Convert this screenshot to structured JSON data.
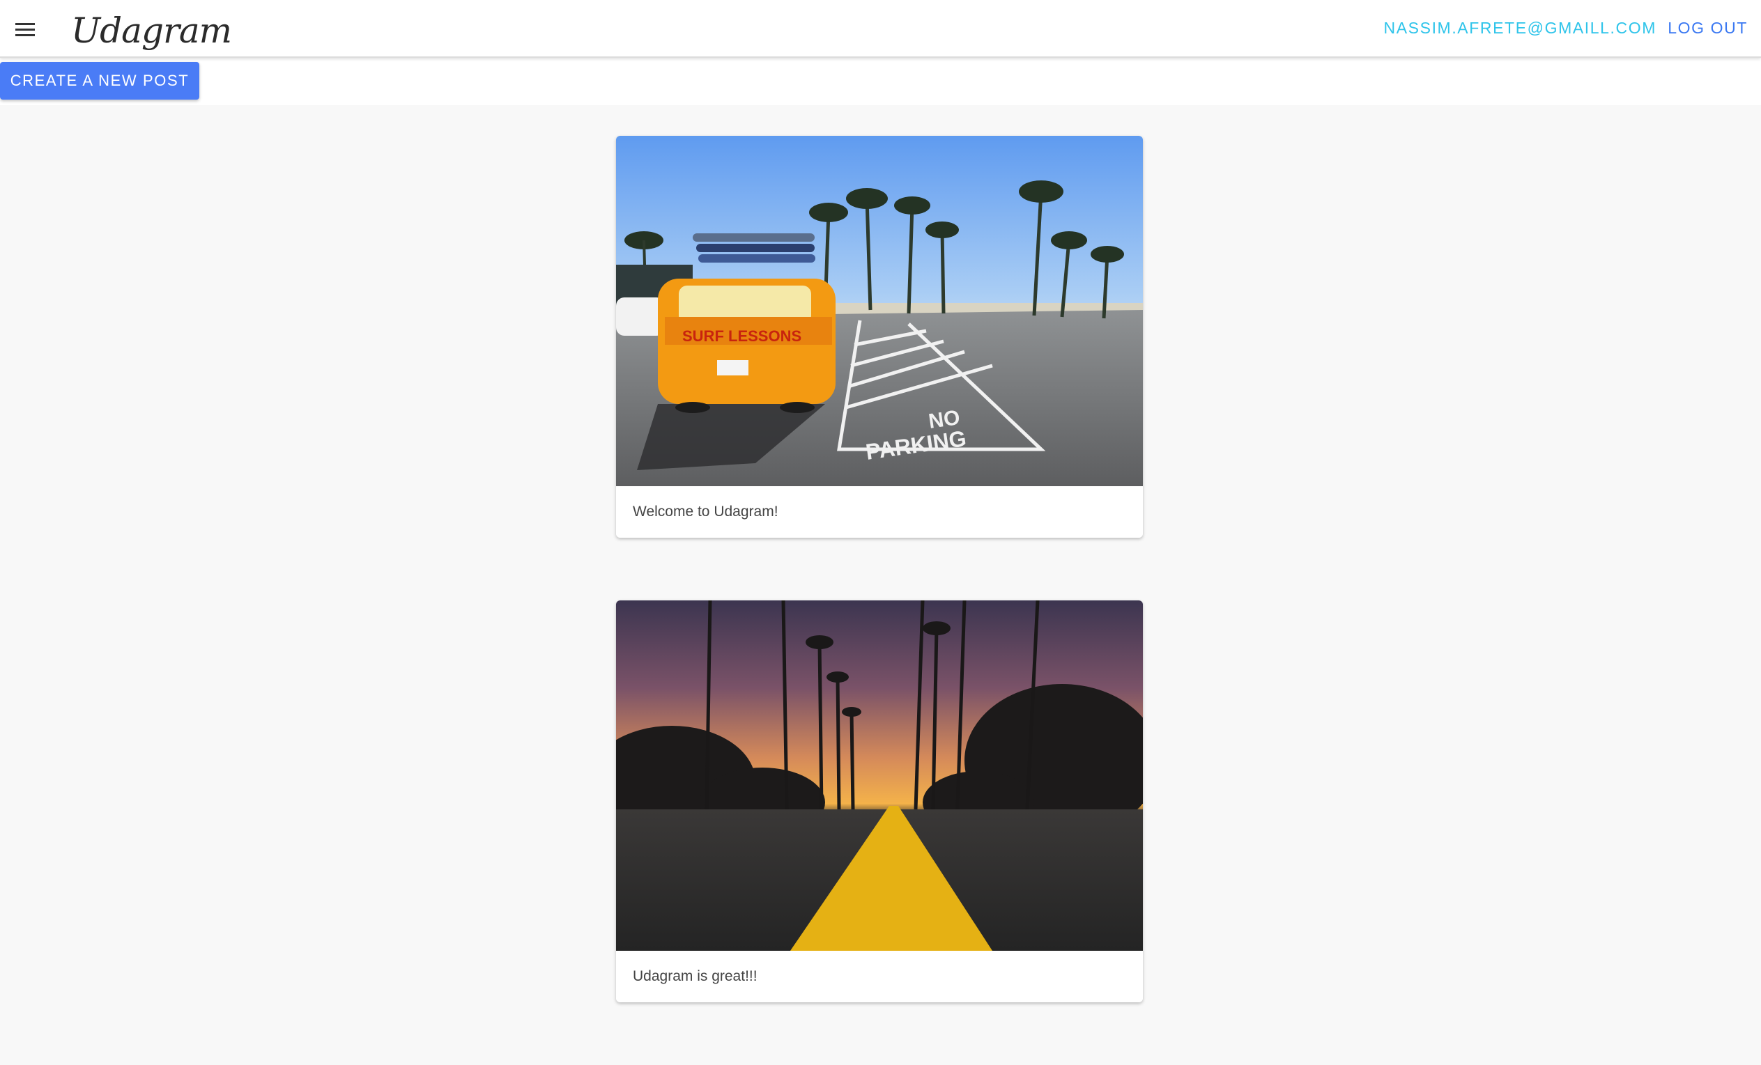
{
  "app": {
    "brand": "Udagram"
  },
  "header": {
    "menu_icon": "hamburger-menu-icon",
    "user_email": "NASSIM.AFRETE@GMAILL.COM",
    "logout_label": "LOG OUT"
  },
  "actions": {
    "create_post_label": "CREATE A NEW POST"
  },
  "posts": [
    {
      "caption": "Welcome to Udagram!",
      "image": "beach-parking-surf-van-photo"
    },
    {
      "caption": "Udagram is great!!!",
      "image": "palm-road-sunset-photo"
    }
  ],
  "colors": {
    "accent": "#4a7cf6",
    "email_link": "#2ec4ea",
    "logout_link": "#3a78f2",
    "background": "#f8f8f8"
  }
}
